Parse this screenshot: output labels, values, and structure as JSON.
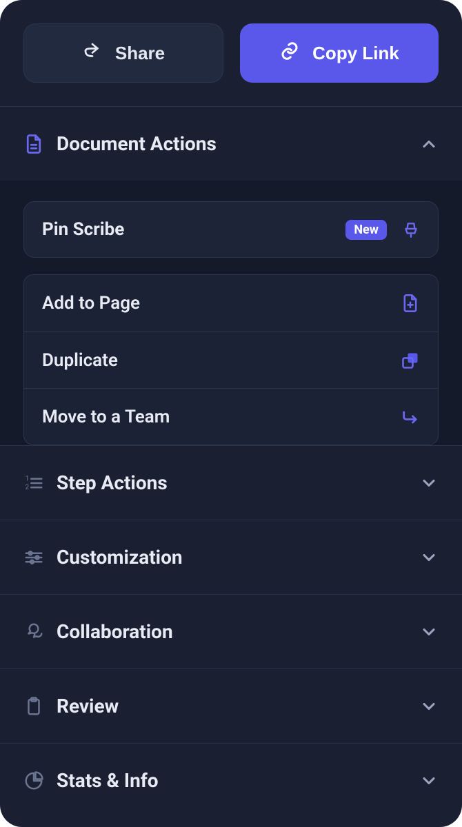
{
  "topbar": {
    "share_label": "Share",
    "copy_label": "Copy Link"
  },
  "sections": {
    "document_actions": {
      "label": "Document Actions",
      "expanded": true,
      "pin_scribe": {
        "label": "Pin Scribe",
        "badge": "New"
      },
      "items": [
        {
          "label": "Add to Page"
        },
        {
          "label": "Duplicate"
        },
        {
          "label": "Move to a Team"
        }
      ]
    },
    "step_actions": {
      "label": "Step Actions"
    },
    "customization": {
      "label": "Customization"
    },
    "collaboration": {
      "label": "Collaboration"
    },
    "review": {
      "label": "Review"
    },
    "stats_info": {
      "label": "Stats & Info"
    }
  }
}
